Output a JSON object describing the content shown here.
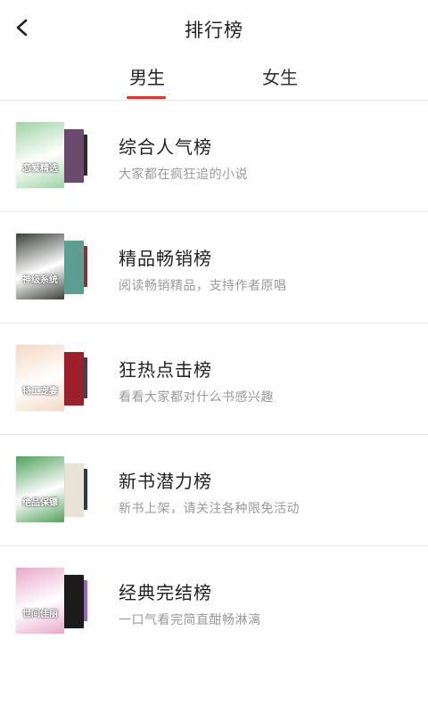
{
  "header": {
    "title": "排行榜",
    "back_icon": "chevron-left-icon"
  },
  "tabs": [
    {
      "label": "男生",
      "active": true
    },
    {
      "label": "女生",
      "active": false
    }
  ],
  "accent_color": "#e8302f",
  "rankings": [
    {
      "title": "综合人气榜",
      "desc": "大家都在疯狂追的小说",
      "cover_text": "恋爱精选",
      "cover_colors": [
        "#9fd3a4",
        "#6b4b6d",
        "#2c2c2c"
      ]
    },
    {
      "title": "精品畅销榜",
      "desc": "阅读畅销精品，支持作者原唱",
      "cover_text": "神级系统",
      "cover_colors": [
        "#3b3f3a",
        "#5d9e93",
        "#7a3a3a"
      ]
    },
    {
      "title": "狂热点击榜",
      "desc": "看看大家都对什么书感兴趣",
      "cover_text": "特工宠妻",
      "cover_colors": [
        "#f3d9c2",
        "#9c1f2b",
        "#4a3b5b"
      ]
    },
    {
      "title": "新书潜力榜",
      "desc": "新书上架，请关注各种限免活动",
      "cover_text": "绝品保镖",
      "cover_colors": [
        "#4fa15b",
        "#e9e2d7",
        "#2f3b4d"
      ]
    },
    {
      "title": "经典完结榜",
      "desc": "一口气看完简直酣畅淋漓",
      "cover_text": "世间佳丽",
      "cover_colors": [
        "#e8a9c9",
        "#1c1c1c",
        "#9a67b8"
      ]
    }
  ]
}
